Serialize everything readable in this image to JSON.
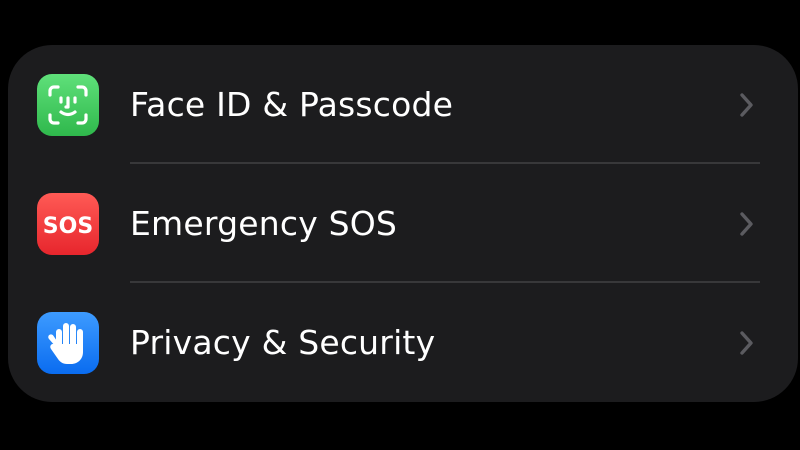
{
  "settings_group": {
    "items": [
      {
        "label": "Face ID & Passcode",
        "icon": "face-id-icon",
        "icon_color": "#34c759"
      },
      {
        "label": "Emergency SOS",
        "icon": "sos-icon",
        "icon_text": "SOS",
        "icon_color": "#ff3b30"
      },
      {
        "label": "Privacy & Security",
        "icon": "hand-raised-icon",
        "icon_color": "#0a84ff"
      }
    ],
    "chevron_icon": "chevron-right-icon"
  },
  "colors": {
    "background": "#000000",
    "group_background": "#1c1c1e",
    "separator": "#38383a",
    "chevron": "#5b5b60",
    "text": "#ffffff"
  }
}
